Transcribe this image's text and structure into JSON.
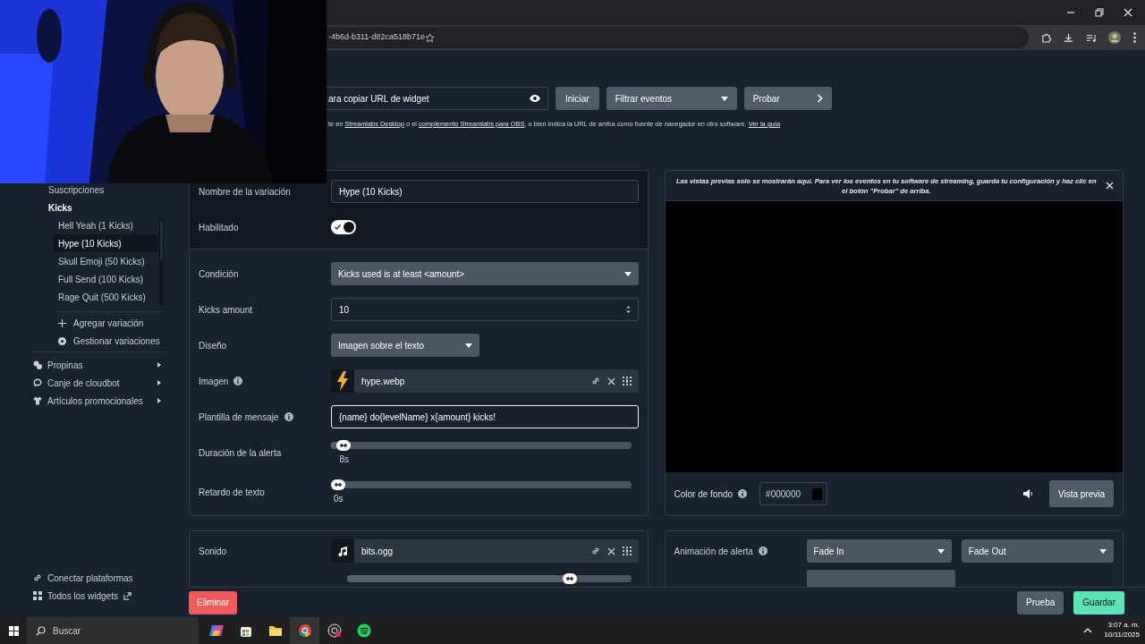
{
  "browser": {
    "url": "-4b6d-b311-d82ca518b71e"
  },
  "widget_url": {
    "value": "ara copiar URL de widget"
  },
  "top_actions": [
    {
      "label": "Iniciar",
      "kind": "button"
    },
    {
      "label": "Filtrar eventos",
      "kind": "select"
    },
    {
      "label": "Probar",
      "kind": "next"
    }
  ],
  "help_text": [
    {
      "text": "te en ",
      "kind": "text"
    },
    {
      "text": "Streamlabs Desktop",
      "kind": "link"
    },
    {
      "text": " o el ",
      "kind": "text"
    },
    {
      "text": "complemento Streamlabs para OBS",
      "kind": "link"
    },
    {
      "text": ", o bien indica la URL de arriba como fuente de navegador en otro software. ",
      "kind": "text"
    },
    {
      "text": "Ver la guía",
      "kind": "link"
    }
  ],
  "sidebar": {
    "items": [
      {
        "label": "Suscripciones",
        "expanded": false
      },
      {
        "label": "Kicks",
        "expanded": true,
        "children": [
          {
            "label": "Hell Yeah (1 Kicks)",
            "selected": false
          },
          {
            "label": "Hype (10 Kicks)",
            "selected": true
          },
          {
            "label": "Skull Emoji (50 Kicks)",
            "selected": false
          },
          {
            "label": "Full Send (100 Kicks)",
            "selected": false
          },
          {
            "label": "Rage Quit (500 Kicks)",
            "selected": false
          }
        ]
      }
    ],
    "actions": [
      {
        "label": "Agregar variación",
        "kind": "add"
      },
      {
        "label": "Gestionar variaciones",
        "kind": "manage"
      }
    ],
    "categories": [
      {
        "label": "Propinas"
      },
      {
        "label": "Canje de cloudbot"
      },
      {
        "label": "Artículos promocionales"
      }
    ],
    "links": [
      {
        "label": "Conectar plataformas"
      },
      {
        "label": "Todos los widgets"
      }
    ]
  },
  "settings": {
    "header_rows": [
      {
        "label": "Nombre de la variación",
        "kind": "text",
        "value": "Hype (10 Kicks)"
      },
      {
        "label": "Habilitado",
        "kind": "toggle",
        "on": true
      }
    ],
    "rows": [
      {
        "label": "Condición",
        "kind": "select",
        "value": "Kicks used is at least <amount>"
      },
      {
        "label": "Kicks amount",
        "kind": "number",
        "value": "10"
      },
      {
        "label": "Diseño",
        "kind": "short_select",
        "value": "Imagen sobre el texto"
      },
      {
        "label": "Imagen",
        "info": true,
        "value": "hype.webp"
      },
      {
        "label": "Plantilla de mensaje",
        "kind": "template",
        "info": true,
        "focused": true,
        "value": "{name} do{levelName} x{amount} kicks!"
      },
      {
        "label": "Duración de la alerta",
        "kind": "slider",
        "level": 0.02,
        "reading": "8s"
      },
      {
        "label": "Retardo de texto",
        "kind": "slider",
        "level": 0,
        "reading": "0s"
      }
    ]
  },
  "preview": {
    "notice": "Las vistas previas solo se mostrarán aquí. Para ver los eventos en tu software de streaming, guarda tu configuración y haz clic en el botón \"Probar\" de arriba.",
    "background": {
      "label": "Color de fondo",
      "value": "#000000"
    },
    "button": "Vista previa"
  },
  "sound": {
    "label": "Sonido",
    "file": "bits.ogg",
    "volume": {
      "level": 0.8
    }
  },
  "animation": {
    "label": "Animación de alerta",
    "in": "Fade In",
    "out": "Fade Out"
  },
  "footer": {
    "delete": "Eliminar",
    "test": "Prueba",
    "save": "Guardar"
  },
  "taskbar": {
    "search_placeholder": "Buscar",
    "time": "3:07 a. m.",
    "date": "10/11/2025"
  }
}
